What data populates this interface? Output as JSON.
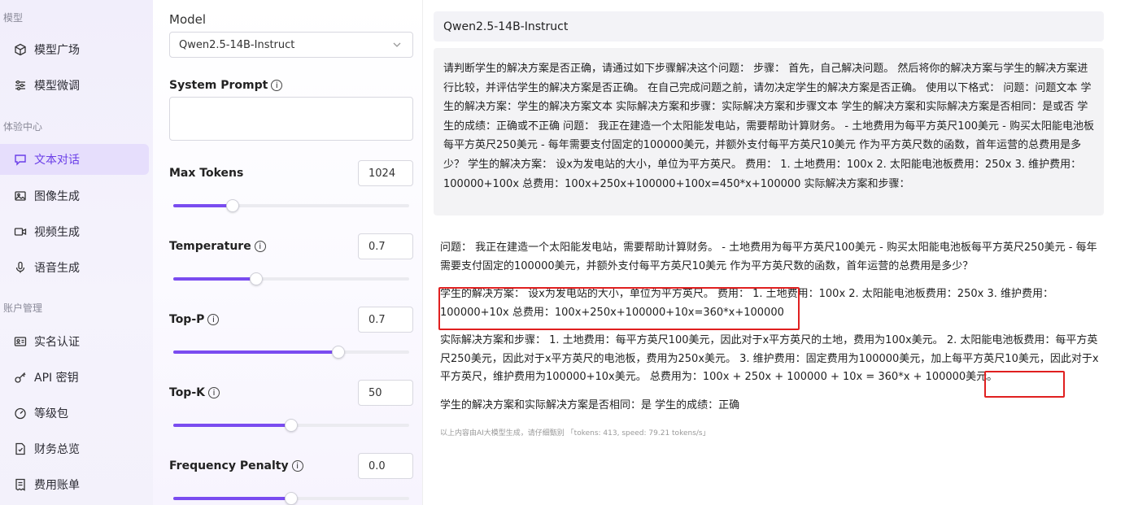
{
  "sidebar": {
    "sections": [
      {
        "title": "模型",
        "items": [
          {
            "label": "模型广场",
            "icon": "cube-icon"
          },
          {
            "label": "模型微调",
            "icon": "sliders-icon"
          }
        ]
      },
      {
        "title": "体验中心",
        "items": [
          {
            "label": "文本对话",
            "icon": "chat-icon",
            "active": true
          },
          {
            "label": "图像生成",
            "icon": "image-icon"
          },
          {
            "label": "视频生成",
            "icon": "video-icon"
          },
          {
            "label": "语音生成",
            "icon": "mic-icon"
          }
        ]
      },
      {
        "title": "账户管理",
        "items": [
          {
            "label": "实名认证",
            "icon": "id-card-icon"
          },
          {
            "label": "API 密钥",
            "icon": "key-icon"
          },
          {
            "label": "等级包",
            "icon": "gauge-icon"
          },
          {
            "label": "财务总览",
            "icon": "finance-doc-icon"
          },
          {
            "label": "费用账单",
            "icon": "bill-icon"
          }
        ]
      }
    ]
  },
  "settings": {
    "model_label": "Model",
    "model_value": "Qwen2.5-14B-Instruct",
    "system_prompt_label": "System Prompt",
    "system_prompt_value": "",
    "params": [
      {
        "label": "Max Tokens",
        "value": "1024",
        "info": false,
        "fraction": 0.25
      },
      {
        "label": "Temperature",
        "value": "0.7",
        "info": true,
        "fraction": 0.35
      },
      {
        "label": "Top-P",
        "value": "0.7",
        "info": true,
        "fraction": 0.7
      },
      {
        "label": "Top-K",
        "value": "50",
        "info": true,
        "fraction": 0.5
      },
      {
        "label": "Frequency Penalty",
        "value": "0.0",
        "info": true,
        "fraction": 0.5
      }
    ]
  },
  "chat": {
    "model_title": "Qwen2.5-14B-Instruct",
    "user_message": "请判断学生的解决方案是否正确，请通过如下步骤解决这个问题：   步骤：   首先，自己解决问题。   然后将你的解决方案与学生的解决方案进行比较，并评估学生的解决方案是否正确。   在自己完成问题之前，请勿决定学生的解决方案是否正确。   使用以下格式：   问题：问题文本   学生的解决方案：学生的解决方案文本   实际解决方案和步骤：实际解决方案和步骤文本   学生的解决方案和实际解决方案是否相同：是或否   学生的成绩：正确或不正确  问题：      我正在建造一个太阳能发电站，需要帮助计算财务。      - 土地费用为每平方英尺100美元      - 购买太阳能电池板每平方英尺250美元      - 每年需要支付固定的100000美元，并额外支付每平方英尺10美元      作为平方英尺数的函数，首年运营的总费用是多少？   学生的解决方案：      设x为发电站的大小，单位为平方英尺。      费用：      1. 土地费用：100x      2. 太阳能电池板费用：250x      3. 维护费用：100000+100x      总费用：100x+250x+100000+100x=450*x+100000  实际解决方案和步骤：",
    "reply_problem": "问题：   我正在建造一个太阳能发电站，需要帮助计算财务。   - 土地费用为每平方英尺100美元   - 购买太阳能电池板每平方英尺250美元   - 每年需要支付固定的100000美元，并额外支付每平方英尺10美元   作为平方英尺数的函数，首年运营的总费用是多少？",
    "reply_student": "学生的解决方案：   设x为发电站的大小，单位为平方英尺。   费用：   1. 土地费用：100x   2. 太阳能电池板费用：250x   3. 维护费用：100000+10x   总费用：100x+250x+100000+10x=360*x+100000",
    "reply_actual": "实际解决方案和步骤：   1. 土地费用：每平方英尺100美元，因此对于x平方英尺的土地，费用为100x美元。   2. 太阳能电池板费用：每平方英尺250美元，因此对于x平方英尺的电池板，费用为250x美元。   3. 维护费用：固定费用为100000美元，加上每平方英尺10美元，因此对于x平方英尺，维护费用为100000+10x美元。   总费用为：100x + 250x + 100000 + 10x = 360*x + 100000美元。",
    "reply_verdict": "学生的解决方案和实际解决方案是否相同：是 学生的成绩：正确",
    "footer": "以上内容由AI大模型生成，请仔细甄别  「tokens: 413, speed: 79.21 tokens/s」"
  },
  "colors": {
    "accent": "#7a4cf0",
    "highlight_box": "#e02020"
  }
}
